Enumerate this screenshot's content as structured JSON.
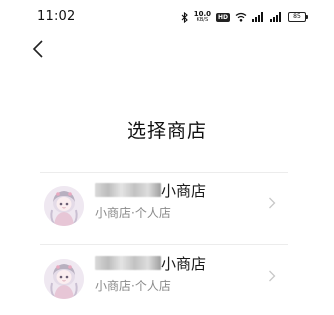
{
  "status_bar": {
    "time": "11:02",
    "net_speed_value": "10.0",
    "net_speed_unit": "KB/S",
    "hd_badge": "HD",
    "battery": "85"
  },
  "header": {
    "title": "选择商店"
  },
  "stores": [
    {
      "name": "小商店",
      "type": "小商店·个人店"
    },
    {
      "name": "小商店",
      "type": "小商店·个人店"
    }
  ],
  "colors": {
    "background": "#ffffff",
    "text_primary": "#1a1a1a",
    "text_secondary": "#8a8a8a",
    "chevron": "#c8c8c8",
    "divider": "#ececec"
  }
}
